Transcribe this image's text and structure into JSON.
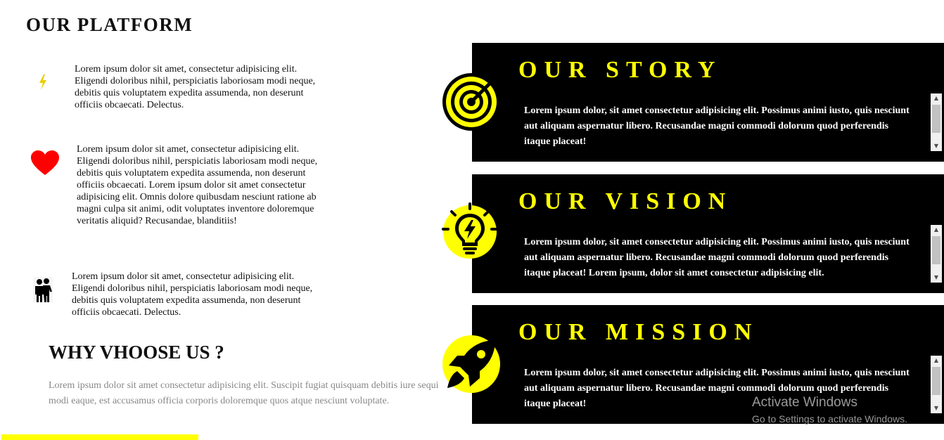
{
  "platform": {
    "title": "OUR PLATFORM",
    "features": [
      {
        "icon": "lightning-bolt-icon",
        "text": "Lorem ipsum dolor sit amet, consectetur adipisicing elit. Eligendi doloribus nihil, perspiciatis laboriosam modi neque, debitis quis voluptatem expedita assumenda, non deserunt officiis obcaecati. Delectus."
      },
      {
        "icon": "heart-icon",
        "text": "Lorem ipsum dolor sit amet, consectetur adipisicing elit. Eligendi doloribus nihil, perspiciatis laboriosam modi neque, debitis quis voluptatem expedita assumenda, non deserunt officiis obcaecati. Lorem ipsum dolor sit amet consectetur adipisicing elit. Omnis dolore quibusdam nesciunt ratione ab magni culpa sit animi, odit voluptates inventore doloremque veritatis aliquid? Recusandae, blanditiis!"
      },
      {
        "icon": "people-icon",
        "text": "Lorem ipsum dolor sit amet, consectetur adipisicing elit. Eligendi doloribus nihil, perspiciatis laboriosam modi neque, debitis quis voluptatem expedita assumenda, non deserunt officiis obcaecati. Delectus."
      }
    ]
  },
  "why": {
    "title": "WHY VHOOSE US ?",
    "text": "Lorem ipsum dolor sit amet consectetur adipisicing elit. Suscipit fugiat quisquam debitis iure sequi modi eaque, est accusamus officia corporis doloremque quos atque nesciunt voluptate."
  },
  "cards": [
    {
      "icon": "target-icon",
      "title": "OUR STORY",
      "text": "Lorem ipsum dolor, sit amet consectetur adipisicing elit. Possimus animi iusto, quis nesciunt aut aliquam aspernatur libero. Recusandae magni commodi dolorum quod perferendis itaque placeat!"
    },
    {
      "icon": "lightbulb-icon",
      "title": "OUR VISION",
      "text": "Lorem ipsum dolor, sit amet consectetur adipisicing elit. Possimus animi iusto, quis nesciunt aut aliquam aspernatur libero. Recusandae magni commodi dolorum quod perferendis itaque placeat! Lorem ipsum, dolor sit amet consectetur adipisicing elit."
    },
    {
      "icon": "rocket-icon",
      "title": "OUR MISSION",
      "text": "Lorem ipsum dolor, sit amet consectetur adipisicing elit. Possimus animi iusto, quis nesciunt aut aliquam aspernatur libero. Recusandae magni commodi dolorum quod perferendis itaque placeat!"
    }
  ],
  "watermark": {
    "line1": "Activate Windows",
    "line2": "Go to Settings to activate Windows."
  },
  "colors": {
    "accent": "#ffff00",
    "card_bg": "#000000",
    "heart": "#ff0000"
  }
}
